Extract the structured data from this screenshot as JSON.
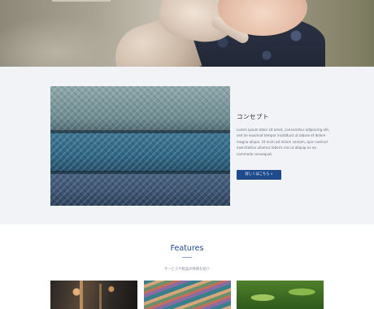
{
  "concept": {
    "title": "コンセプト",
    "body": "Lorem ipsum dolor sit amet, consectetur adipiscing elit, sed do eiusmod tempor incididunt ut labore et dolore magna aliqua. Ut enim ad minim veniam, quis nostrud exercitation ullamco laboris nisi ut aliquip ex ea commodo consequat.",
    "button_label": "詳しくはこちら »"
  },
  "features": {
    "title": "Features",
    "subtitle": "サービスや製品の特徴を紹介"
  }
}
